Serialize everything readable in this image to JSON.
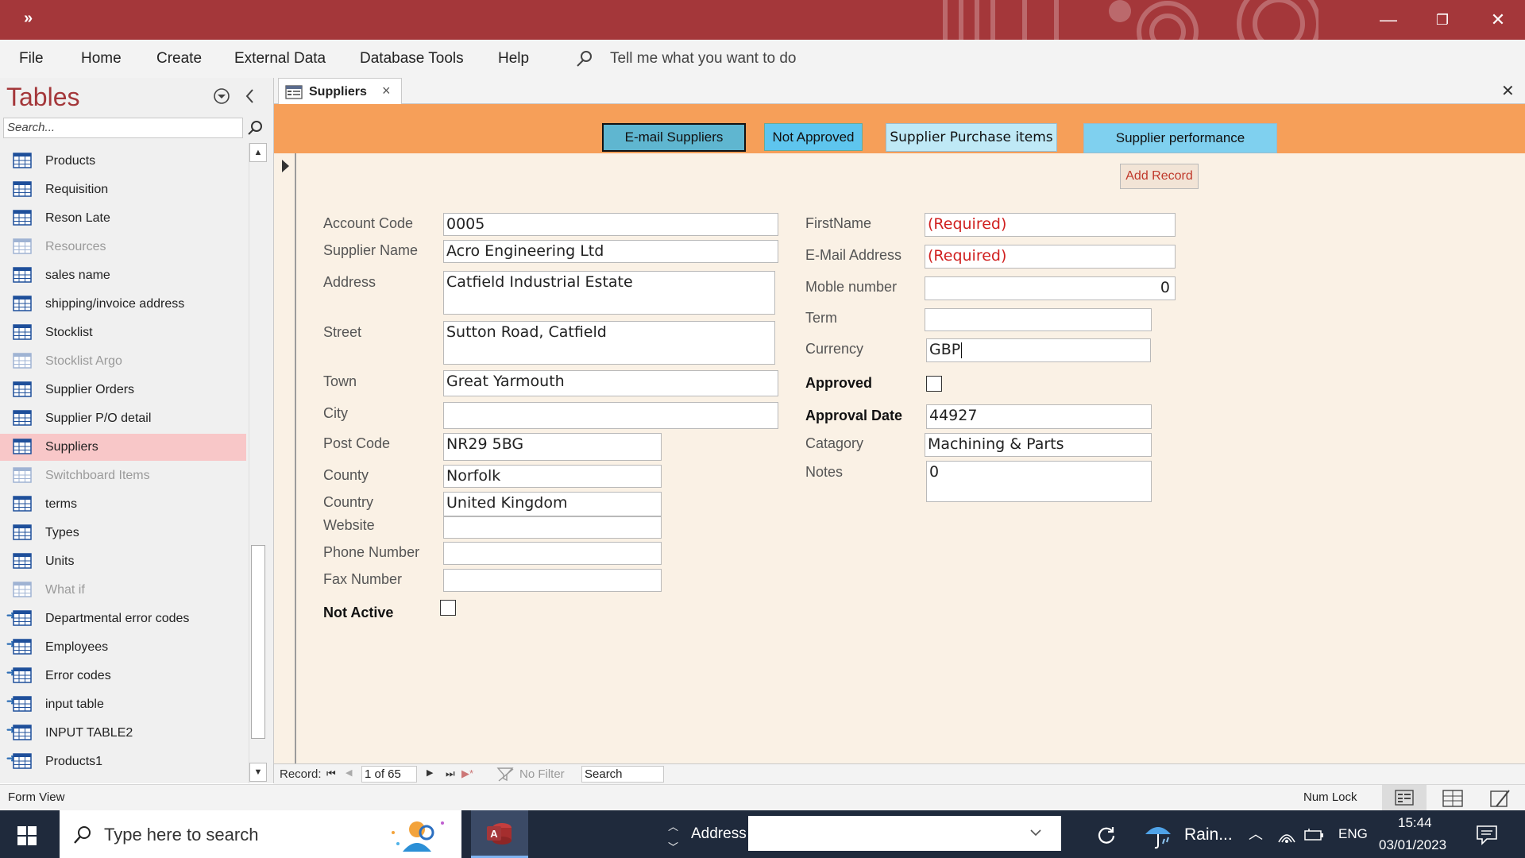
{
  "titlebar": {
    "qat_label": "»",
    "minimize": "—",
    "restore": "❐",
    "close": "✕"
  },
  "menu": {
    "items": [
      "File",
      "Home",
      "Create",
      "External Data",
      "Database Tools",
      "Help"
    ],
    "tell_me": "Tell me what you want to do"
  },
  "nav": {
    "title": "Tables",
    "search_placeholder": "Search...",
    "items": [
      {
        "label": "Products",
        "state": "normal"
      },
      {
        "label": "Requisition",
        "state": "normal"
      },
      {
        "label": "Reson Late",
        "state": "normal"
      },
      {
        "label": "Resources",
        "state": "disabled"
      },
      {
        "label": "sales name",
        "state": "normal"
      },
      {
        "label": "shipping/invoice address",
        "state": "normal"
      },
      {
        "label": "Stocklist",
        "state": "normal"
      },
      {
        "label": "Stocklist Argo",
        "state": "disabled"
      },
      {
        "label": "Supplier Orders",
        "state": "normal"
      },
      {
        "label": "Supplier P/O detail",
        "state": "normal"
      },
      {
        "label": "Suppliers",
        "state": "selected"
      },
      {
        "label": "Switchboard Items",
        "state": "disabled"
      },
      {
        "label": "terms",
        "state": "normal"
      },
      {
        "label": "Types",
        "state": "normal"
      },
      {
        "label": "Units",
        "state": "normal"
      },
      {
        "label": "What if",
        "state": "disabled"
      },
      {
        "label": "Departmental error codes",
        "state": "linked"
      },
      {
        "label": "Employees",
        "state": "linked"
      },
      {
        "label": "Error codes",
        "state": "linked"
      },
      {
        "label": "input table",
        "state": "linked"
      },
      {
        "label": "INPUT TABLE2",
        "state": "linked"
      },
      {
        "label": "Products1",
        "state": "linked"
      }
    ]
  },
  "doc": {
    "tab_label": "Suppliers",
    "tab_close": "×",
    "close_all": "✕"
  },
  "form": {
    "header_buttons": {
      "email": "E-mail Suppliers",
      "not_approved": "Not Approved",
      "purchase_items": "Supplier Purchase items",
      "performance": "Supplier performance"
    },
    "add_record": "Add Record",
    "left_fields": {
      "account_code": {
        "label": "Account Code",
        "value": "0005"
      },
      "supplier_name": {
        "label": "Supplier Name",
        "value": "Acro Engineering Ltd"
      },
      "address": {
        "label": "Address",
        "value": "Catfield Industrial Estate"
      },
      "street": {
        "label": "Street",
        "value": "Sutton Road, Catfield"
      },
      "town": {
        "label": "Town",
        "value": "Great Yarmouth"
      },
      "city": {
        "label": "City",
        "value": ""
      },
      "post_code": {
        "label": "Post Code",
        "value": "NR29 5BG"
      },
      "county": {
        "label": "County",
        "value": "Norfolk"
      },
      "country": {
        "label": "Country",
        "value": "United Kingdom"
      },
      "website": {
        "label": "Website",
        "value": ""
      },
      "phone": {
        "label": "Phone Number",
        "value": ""
      },
      "fax": {
        "label": "Fax Number",
        "value": ""
      },
      "not_active": {
        "label": "Not Active",
        "checked": false
      }
    },
    "right_fields": {
      "first_name": {
        "label": "FirstName",
        "value": "(Required)"
      },
      "email": {
        "label": "E-Mail Address",
        "value": "(Required)"
      },
      "mobile": {
        "label": "Moble number",
        "value": "0"
      },
      "term": {
        "label": "Term",
        "value": ""
      },
      "currency": {
        "label": "Currency",
        "value": "GBP"
      },
      "approved": {
        "label": "Approved",
        "checked": false
      },
      "approval_date": {
        "label": "Approval Date",
        "value": "44927"
      },
      "category": {
        "label": "Catagory",
        "value": "Machining & Parts"
      },
      "notes": {
        "label": "Notes",
        "value": "0"
      }
    }
  },
  "record_nav": {
    "label": "Record:",
    "position": "1 of 65",
    "filter": "No Filter",
    "search": "Search"
  },
  "status": {
    "view": "Form View",
    "num_lock": "Num Lock"
  },
  "taskbar": {
    "search_placeholder": "Type here to search",
    "address_label": "Address",
    "weather": "Rain...",
    "language": "ENG",
    "time": "15:44",
    "date": "03/01/2023"
  },
  "colors": {
    "accent": "#a4373a",
    "form_header": "#f69f59",
    "form_body": "#faf1e5",
    "selected_nav": "#f8c7c8",
    "required_text": "#d0201f"
  }
}
